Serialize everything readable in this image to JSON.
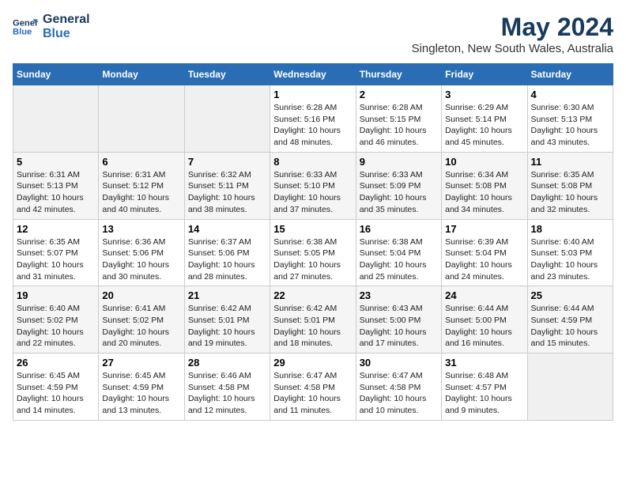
{
  "header": {
    "logo_line1": "General",
    "logo_line2": "Blue",
    "month": "May 2024",
    "location": "Singleton, New South Wales, Australia"
  },
  "days_of_week": [
    "Sunday",
    "Monday",
    "Tuesday",
    "Wednesday",
    "Thursday",
    "Friday",
    "Saturday"
  ],
  "weeks": [
    [
      {
        "day": "",
        "sunrise": "",
        "sunset": "",
        "daylight": ""
      },
      {
        "day": "",
        "sunrise": "",
        "sunset": "",
        "daylight": ""
      },
      {
        "day": "",
        "sunrise": "",
        "sunset": "",
        "daylight": ""
      },
      {
        "day": "1",
        "sunrise": "Sunrise: 6:28 AM",
        "sunset": "Sunset: 5:16 PM",
        "daylight": "Daylight: 10 hours and 48 minutes."
      },
      {
        "day": "2",
        "sunrise": "Sunrise: 6:28 AM",
        "sunset": "Sunset: 5:15 PM",
        "daylight": "Daylight: 10 hours and 46 minutes."
      },
      {
        "day": "3",
        "sunrise": "Sunrise: 6:29 AM",
        "sunset": "Sunset: 5:14 PM",
        "daylight": "Daylight: 10 hours and 45 minutes."
      },
      {
        "day": "4",
        "sunrise": "Sunrise: 6:30 AM",
        "sunset": "Sunset: 5:13 PM",
        "daylight": "Daylight: 10 hours and 43 minutes."
      }
    ],
    [
      {
        "day": "5",
        "sunrise": "Sunrise: 6:31 AM",
        "sunset": "Sunset: 5:13 PM",
        "daylight": "Daylight: 10 hours and 42 minutes."
      },
      {
        "day": "6",
        "sunrise": "Sunrise: 6:31 AM",
        "sunset": "Sunset: 5:12 PM",
        "daylight": "Daylight: 10 hours and 40 minutes."
      },
      {
        "day": "7",
        "sunrise": "Sunrise: 6:32 AM",
        "sunset": "Sunset: 5:11 PM",
        "daylight": "Daylight: 10 hours and 38 minutes."
      },
      {
        "day": "8",
        "sunrise": "Sunrise: 6:33 AM",
        "sunset": "Sunset: 5:10 PM",
        "daylight": "Daylight: 10 hours and 37 minutes."
      },
      {
        "day": "9",
        "sunrise": "Sunrise: 6:33 AM",
        "sunset": "Sunset: 5:09 PM",
        "daylight": "Daylight: 10 hours and 35 minutes."
      },
      {
        "day": "10",
        "sunrise": "Sunrise: 6:34 AM",
        "sunset": "Sunset: 5:08 PM",
        "daylight": "Daylight: 10 hours and 34 minutes."
      },
      {
        "day": "11",
        "sunrise": "Sunrise: 6:35 AM",
        "sunset": "Sunset: 5:08 PM",
        "daylight": "Daylight: 10 hours and 32 minutes."
      }
    ],
    [
      {
        "day": "12",
        "sunrise": "Sunrise: 6:35 AM",
        "sunset": "Sunset: 5:07 PM",
        "daylight": "Daylight: 10 hours and 31 minutes."
      },
      {
        "day": "13",
        "sunrise": "Sunrise: 6:36 AM",
        "sunset": "Sunset: 5:06 PM",
        "daylight": "Daylight: 10 hours and 30 minutes."
      },
      {
        "day": "14",
        "sunrise": "Sunrise: 6:37 AM",
        "sunset": "Sunset: 5:06 PM",
        "daylight": "Daylight: 10 hours and 28 minutes."
      },
      {
        "day": "15",
        "sunrise": "Sunrise: 6:38 AM",
        "sunset": "Sunset: 5:05 PM",
        "daylight": "Daylight: 10 hours and 27 minutes."
      },
      {
        "day": "16",
        "sunrise": "Sunrise: 6:38 AM",
        "sunset": "Sunset: 5:04 PM",
        "daylight": "Daylight: 10 hours and 25 minutes."
      },
      {
        "day": "17",
        "sunrise": "Sunrise: 6:39 AM",
        "sunset": "Sunset: 5:04 PM",
        "daylight": "Daylight: 10 hours and 24 minutes."
      },
      {
        "day": "18",
        "sunrise": "Sunrise: 6:40 AM",
        "sunset": "Sunset: 5:03 PM",
        "daylight": "Daylight: 10 hours and 23 minutes."
      }
    ],
    [
      {
        "day": "19",
        "sunrise": "Sunrise: 6:40 AM",
        "sunset": "Sunset: 5:02 PM",
        "daylight": "Daylight: 10 hours and 22 minutes."
      },
      {
        "day": "20",
        "sunrise": "Sunrise: 6:41 AM",
        "sunset": "Sunset: 5:02 PM",
        "daylight": "Daylight: 10 hours and 20 minutes."
      },
      {
        "day": "21",
        "sunrise": "Sunrise: 6:42 AM",
        "sunset": "Sunset: 5:01 PM",
        "daylight": "Daylight: 10 hours and 19 minutes."
      },
      {
        "day": "22",
        "sunrise": "Sunrise: 6:42 AM",
        "sunset": "Sunset: 5:01 PM",
        "daylight": "Daylight: 10 hours and 18 minutes."
      },
      {
        "day": "23",
        "sunrise": "Sunrise: 6:43 AM",
        "sunset": "Sunset: 5:00 PM",
        "daylight": "Daylight: 10 hours and 17 minutes."
      },
      {
        "day": "24",
        "sunrise": "Sunrise: 6:44 AM",
        "sunset": "Sunset: 5:00 PM",
        "daylight": "Daylight: 10 hours and 16 minutes."
      },
      {
        "day": "25",
        "sunrise": "Sunrise: 6:44 AM",
        "sunset": "Sunset: 4:59 PM",
        "daylight": "Daylight: 10 hours and 15 minutes."
      }
    ],
    [
      {
        "day": "26",
        "sunrise": "Sunrise: 6:45 AM",
        "sunset": "Sunset: 4:59 PM",
        "daylight": "Daylight: 10 hours and 14 minutes."
      },
      {
        "day": "27",
        "sunrise": "Sunrise: 6:45 AM",
        "sunset": "Sunset: 4:59 PM",
        "daylight": "Daylight: 10 hours and 13 minutes."
      },
      {
        "day": "28",
        "sunrise": "Sunrise: 6:46 AM",
        "sunset": "Sunset: 4:58 PM",
        "daylight": "Daylight: 10 hours and 12 minutes."
      },
      {
        "day": "29",
        "sunrise": "Sunrise: 6:47 AM",
        "sunset": "Sunset: 4:58 PM",
        "daylight": "Daylight: 10 hours and 11 minutes."
      },
      {
        "day": "30",
        "sunrise": "Sunrise: 6:47 AM",
        "sunset": "Sunset: 4:58 PM",
        "daylight": "Daylight: 10 hours and 10 minutes."
      },
      {
        "day": "31",
        "sunrise": "Sunrise: 6:48 AM",
        "sunset": "Sunset: 4:57 PM",
        "daylight": "Daylight: 10 hours and 9 minutes."
      },
      {
        "day": "",
        "sunrise": "",
        "sunset": "",
        "daylight": ""
      }
    ]
  ]
}
